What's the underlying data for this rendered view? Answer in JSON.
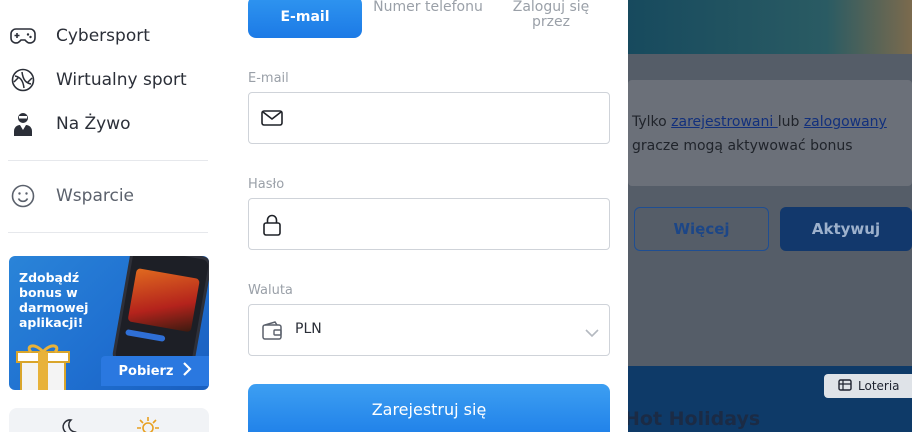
{
  "sidebar": {
    "items": [
      {
        "label": "Cybersport",
        "icon": "gamepad-icon"
      },
      {
        "label": "Wirtualny sport",
        "icon": "ball-icon"
      },
      {
        "label": "Na Żywo",
        "icon": "live-person-icon"
      }
    ],
    "support_label": "Wsparcie",
    "promo": {
      "text": "Zdobądź bonus w darmowej aplikacji!",
      "button_label": "Pobierz"
    },
    "theme_icons": [
      "moon-icon",
      "sun-icon"
    ]
  },
  "modal": {
    "tabs": {
      "email": "E-mail",
      "phone": "Numer telefonu",
      "login": "Zaloguj się przez"
    },
    "email_label": "E-mail",
    "email_value": "",
    "password_label": "Hasło",
    "password_value": "",
    "currency_label": "Waluta",
    "currency_value": "PLN",
    "submit_label": "Zarejestruj się"
  },
  "background": {
    "bonus_text_prefix": "Tylko ",
    "link_registered": "zarejestrowani ",
    "text_middle": "lub ",
    "link_logged": "zalogowany",
    "text_suffix": " gracze mogą aktywować bonus",
    "more_button": "Więcej",
    "activate_button": "Aktywuj",
    "loteria_label": "Loteria",
    "section_title": "Hot Holidays"
  },
  "colors": {
    "accent": "#1f7fe8",
    "overlay": "#555d68"
  }
}
